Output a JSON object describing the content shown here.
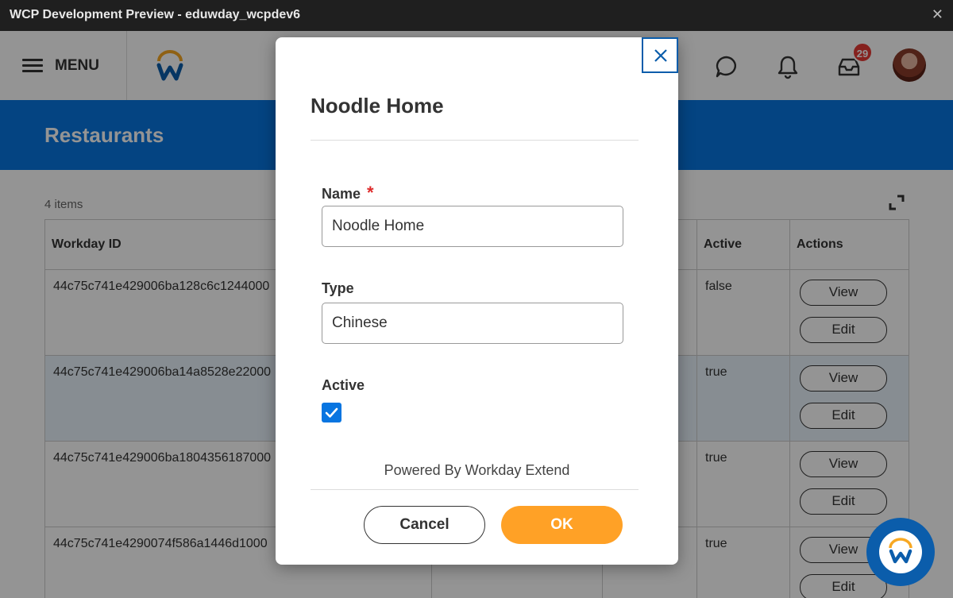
{
  "window": {
    "title": "WCP Development Preview - eduwday_wcpdev6",
    "close_glyph": "✕"
  },
  "nav": {
    "menu_label": "MENU",
    "inbox_badge": "29",
    "icons": [
      "menu-icon",
      "workday-logo-icon",
      "chat-icon",
      "bell-icon",
      "inbox-icon"
    ]
  },
  "page": {
    "title": "Restaurants",
    "item_count": "4 items"
  },
  "table": {
    "headers": [
      "Workday ID",
      "Active",
      "Actions"
    ],
    "rows": [
      {
        "id": "44c75c741e429006ba128c6c1244000",
        "active": "false",
        "view": "View",
        "edit": "Edit"
      },
      {
        "id": "44c75c741e429006ba14a8528e22000",
        "active": "true",
        "view": "View",
        "edit": "Edit"
      },
      {
        "id": "44c75c741e429006ba1804356187000",
        "active": "true",
        "view": "View",
        "edit": "Edit"
      },
      {
        "id": "44c75c741e4290074f586a1446d1000",
        "active": "true",
        "view": "View",
        "edit": "Edit"
      }
    ]
  },
  "modal": {
    "title": "Noodle Home",
    "name_label": "Name",
    "required_mark": "*",
    "name_value": "Noodle Home",
    "type_label": "Type",
    "type_value": "Chinese",
    "active_label": "Active",
    "active_checked": true,
    "powered_by": "Powered By Workday Extend",
    "cancel_label": "Cancel",
    "ok_label": "OK"
  },
  "colors": {
    "brand_blue": "#0875e1",
    "ok_orange": "#ffa126",
    "badge_red": "#e53935"
  }
}
